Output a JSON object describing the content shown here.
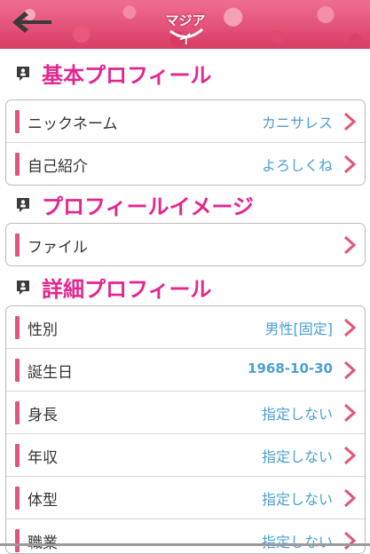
{
  "header": {
    "logo_text": "マジアイ",
    "back_icon": "back-arrow-icon"
  },
  "sections": {
    "basic": {
      "title": "基本プロフィール",
      "rows": [
        {
          "label": "ニックネーム",
          "value": "カニサレス"
        },
        {
          "label": "自己紹介",
          "value": "よろしくね"
        }
      ]
    },
    "image": {
      "title": "プロフィールイメージ",
      "rows": [
        {
          "label": "ファイル",
          "value": ""
        }
      ]
    },
    "detail": {
      "title": "詳細プロフィール",
      "rows": [
        {
          "label": "性別",
          "value": "男性[固定]"
        },
        {
          "label": "誕生日",
          "value": "1968-10-30"
        },
        {
          "label": "身長",
          "value": "指定しない"
        },
        {
          "label": "年収",
          "value": "指定しない"
        },
        {
          "label": "体型",
          "value": "指定しない"
        },
        {
          "label": "職業",
          "value": "指定しない"
        }
      ]
    }
  },
  "colors": {
    "accent_pink": "#e5258f",
    "value_blue": "#4a9fd5",
    "bar_pink": "#e0557a",
    "chevron_pink": "#e0557a"
  }
}
